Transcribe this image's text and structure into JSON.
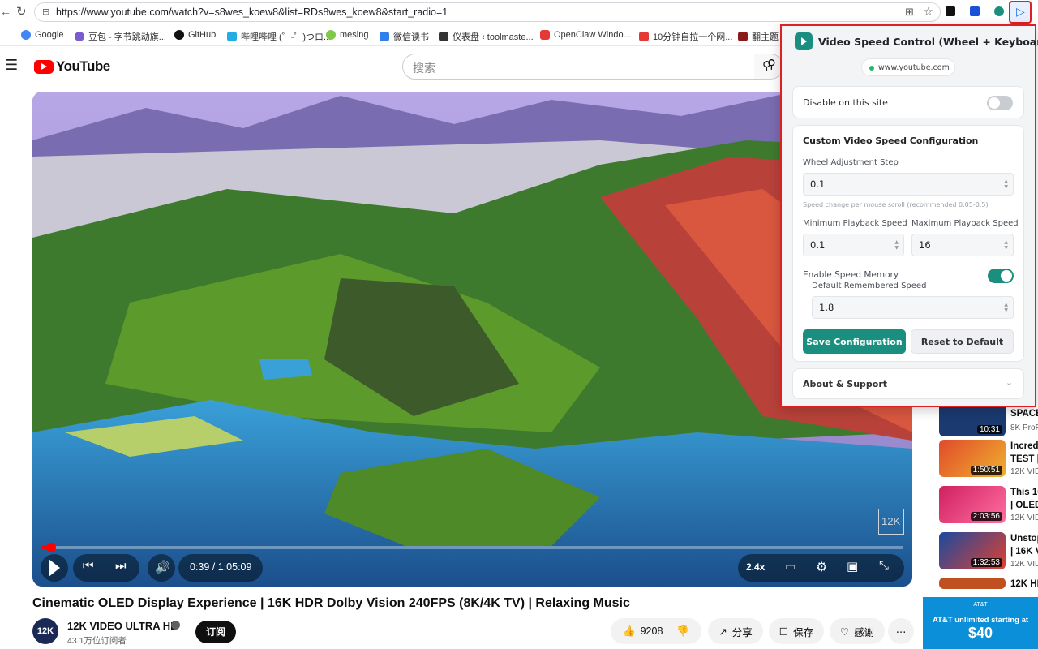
{
  "browser": {
    "url": "https://www.youtube.com/watch?v=s8wes_koew8&list=RDs8wes_koew8&start_radio=1",
    "bookmarks": [
      "Google",
      "豆包 - 字节跳动旗...",
      "GitHub",
      "哔哩哔哩 (゜-゜)つロ...",
      "mesing",
      "微信读书",
      "仪表盘 ‹ toolmaste...",
      "OpenClaw Windo...",
      "10分钟自拉一个网...",
      "翻主题"
    ]
  },
  "youtube": {
    "logo": "YouTube",
    "search_placeholder": "搜索",
    "player": {
      "time": "0:39 / 1:05:09",
      "speed_badge": "2.4x",
      "watermark": "12K",
      "progress": 0.01
    },
    "title": "Cinematic OLED Display Experience | 16K HDR Dolby Vision 240FPS (8K/4K TV) | Relaxing Music",
    "channel": {
      "avatar": "12K",
      "name": "12K VIDEO ULTRA HD",
      "subs": "43.1万位订阅者",
      "subscribe": "订阅"
    },
    "actions": {
      "likes": "9208",
      "share": "分享",
      "save": "保存",
      "thanks": "感谢"
    },
    "sidebar": [
      {
        "title": "SPACE",
        "sub": "8K ProR",
        "dur": "10:31"
      },
      {
        "title": "Incredi",
        "title2": "TEST |",
        "sub": "12K VID",
        "dur": "1:50:51"
      },
      {
        "title": "This 16",
        "title2": "| OLED",
        "sub": "12K VID",
        "dur": "2:03:56"
      },
      {
        "title": "Unstop",
        "title2": "| 16K V",
        "sub": "12K VID",
        "dur": "1:32:53"
      },
      {
        "title": "12K HD",
        "sub": "",
        "dur": ""
      }
    ],
    "ad": {
      "brand": "AT&T",
      "headline": "AT&T unlimited starting at",
      "price": "$40"
    }
  },
  "popup": {
    "title": "Video Speed Control (Wheel + Keyboard)",
    "site": "www.youtube.com",
    "disable_label": "Disable on this site",
    "disable_on": false,
    "config_title": "Custom Video Speed Configuration",
    "wheel_step_label": "Wheel Adjustment Step",
    "wheel_step_value": "0.1",
    "wheel_step_hint": "Speed change per mouse scroll (recommended 0.05-0.5)",
    "min_label": "Minimum Playback Speed",
    "min_value": "0.1",
    "max_label": "Maximum Playback Speed",
    "max_value": "16",
    "memory_label": "Enable Speed Memory",
    "memory_on": true,
    "default_speed_label": "Default Remembered Speed",
    "default_speed_value": "1.8",
    "save_label": "Save Configuration",
    "reset_label": "Reset to Default",
    "about_label": "About & Support",
    "accent": "#1a8f80"
  }
}
